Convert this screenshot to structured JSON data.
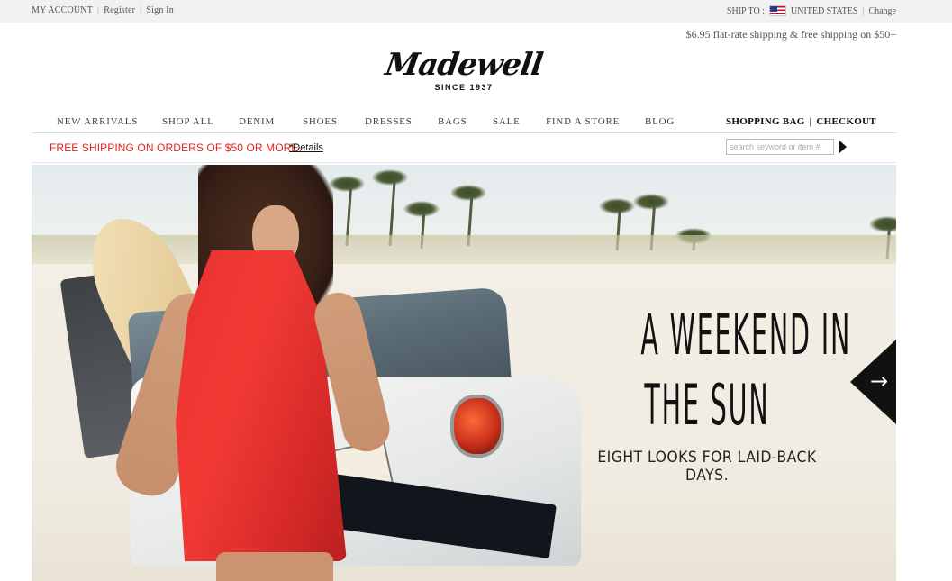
{
  "utility": {
    "my_account": "MY ACCOUNT",
    "register": "Register",
    "sign_in": "Sign In",
    "ship_to_label": "SHIP TO :",
    "ship_to_country": "UNITED STATES",
    "change": "Change",
    "separator": "|"
  },
  "shipping_promo": "$6.95 flat-rate shipping & free shipping on $50+",
  "logo": {
    "wordmark": "Madewell",
    "tagline": "SINCE 1937"
  },
  "nav": {
    "items": [
      "NEW ARRIVALS",
      "SHOP ALL",
      "DENIM",
      "SHOES",
      "DRESSES",
      "BAGS",
      "SALE",
      "FIND A STORE",
      "BLOG"
    ],
    "shopping_bag": "SHOPPING BAG",
    "checkout": "CHECKOUT",
    "separator": "|"
  },
  "promo_bar": {
    "text": "FREE SHIPPING ON ORDERS OF $50 OR MORE.",
    "details": "*Details",
    "search_placeholder": "search keyword or item #"
  },
  "hero": {
    "headline_line1": "A WEEKEND IN",
    "headline_line2": "THE SUN",
    "subhead": "EIGHT LOOKS FOR LAID-BACK DAYS.",
    "next_icon": "→"
  },
  "colors": {
    "promo_red": "#e2231a",
    "dress_red": "#e8302f",
    "utility_bg": "#f1f1f1"
  }
}
